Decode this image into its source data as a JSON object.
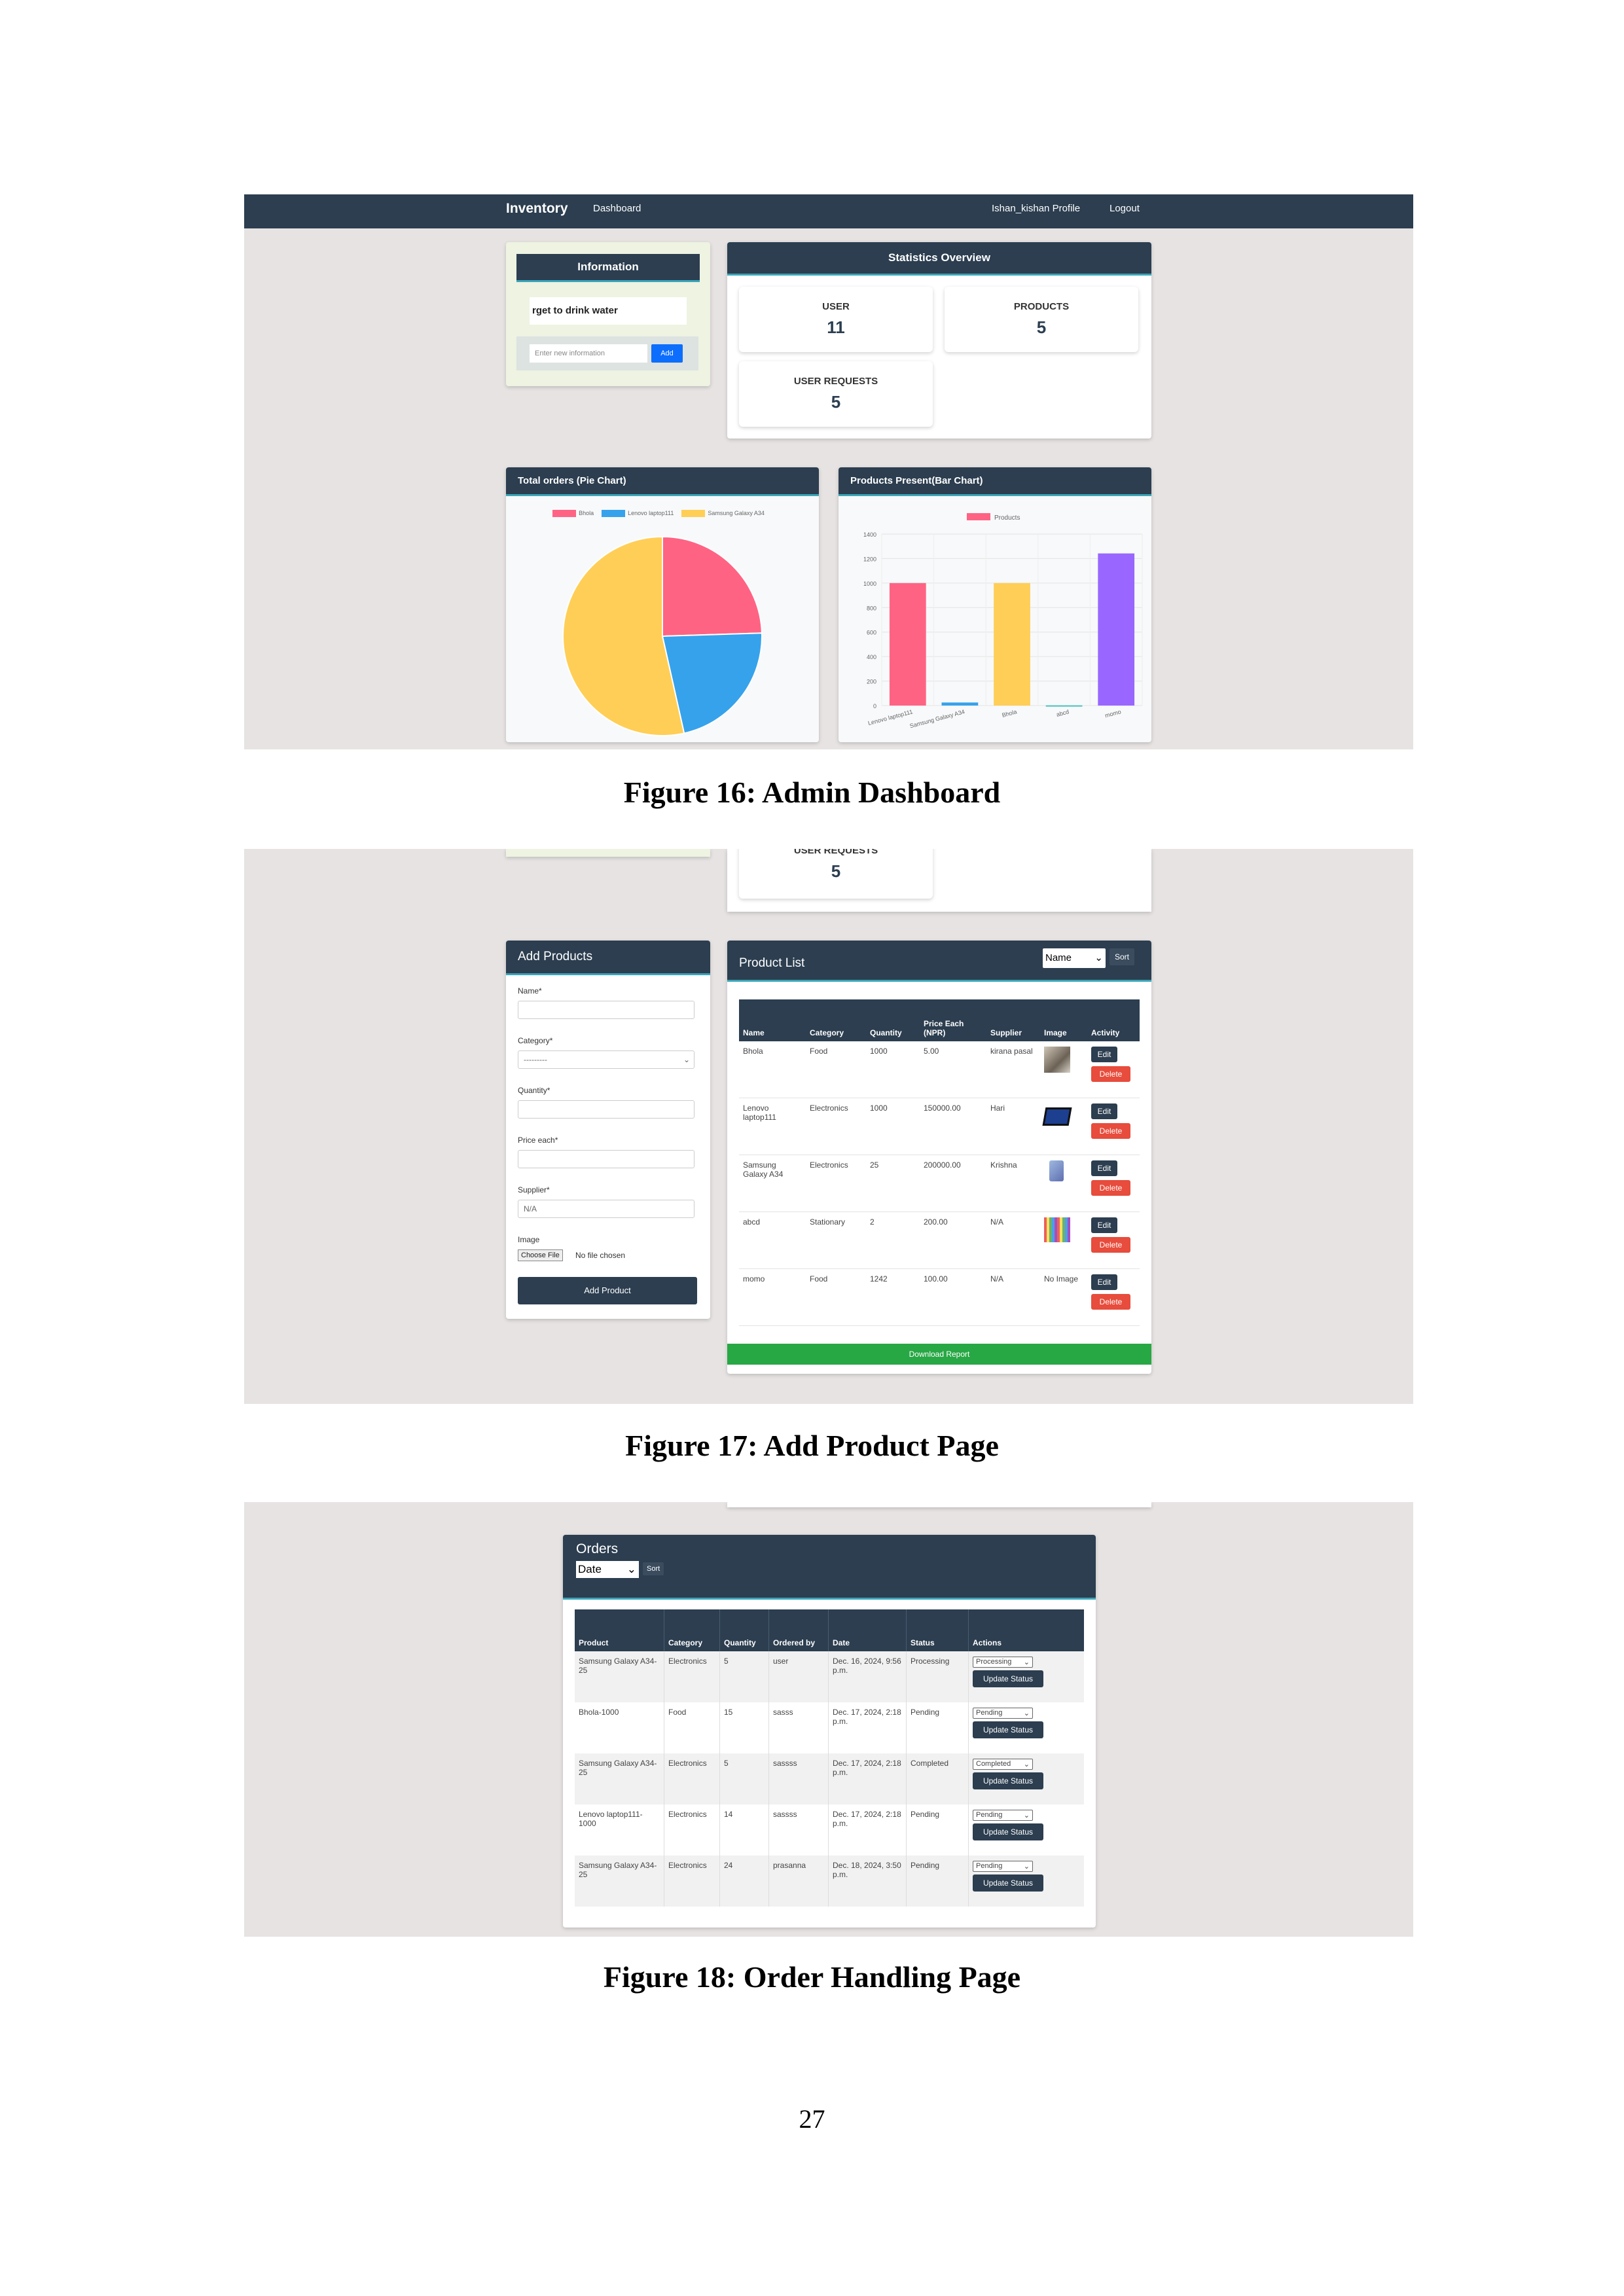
{
  "fig16": {
    "caption": "Figure 16: Admin Dashboard",
    "nav": {
      "brand": "Inventory",
      "dashboard": "Dashboard",
      "profile": "Ishan_kishan Profile",
      "logout": "Logout"
    },
    "info": {
      "title": "Information",
      "note": "rget to drink water",
      "placeholder": "Enter new information",
      "add": "Add"
    },
    "stats": {
      "title": "Statistics Overview",
      "user_label": "USER",
      "user_value": "11",
      "products_label": "PRODUCTS",
      "products_value": "5",
      "requests_label": "USER REQUESTS",
      "requests_value": "5"
    },
    "pie_title": "Total orders (Pie Chart)",
    "bar_title": "Products Present(Bar Chart)"
  },
  "chart_data": [
    {
      "type": "pie",
      "title": "Total orders (Pie Chart)",
      "categories": [
        "Bhola",
        "Lenovo laptop111",
        "Samsung Galaxy A34"
      ],
      "values": [
        24.5,
        22,
        53.5
      ],
      "colors": [
        "#ff6384",
        "#36a2eb",
        "#ffce56"
      ],
      "legend": "top"
    },
    {
      "type": "bar",
      "title": "Products Present(Bar Chart)",
      "categories": [
        "Lenovo laptop111",
        "Samsung Galaxy A34",
        "Bhola",
        "abcd",
        "momo"
      ],
      "series": [
        {
          "name": "Products",
          "values": [
            1000,
            25,
            1000,
            2,
            1242
          ]
        }
      ],
      "colors": [
        "#ff6384",
        "#36a2eb",
        "#ffce56",
        "#4bc0c0",
        "#9966ff"
      ],
      "ylim": [
        0,
        1400
      ],
      "yticks": [
        "0",
        "200",
        "400",
        "600",
        "800",
        "1000",
        "1200",
        "1400"
      ],
      "grid": true,
      "legend": "top"
    }
  ],
  "fig17": {
    "caption": "Figure 17: Add Product Page",
    "requests_label": "USER REQUESTS",
    "requests_value": "5",
    "form": {
      "title": "Add Products",
      "name_label": "Name*",
      "category_label": "Category*",
      "category_value": "---------",
      "quantity_label": "Quantity*",
      "price_label": "Price each*",
      "supplier_label": "Supplier*",
      "supplier_value": "N/A",
      "image_label": "Image",
      "choose_file": "Choose File",
      "no_file": "No file chosen",
      "submit": "Add Product"
    },
    "list": {
      "title": "Product List",
      "sort_select": "Name",
      "sort_button": "Sort",
      "headers": [
        "Name",
        "Category",
        "Quantity",
        "Price Each (NPR)",
        "Supplier",
        "Image",
        "Activity"
      ],
      "rows": [
        {
          "name": "Bhola",
          "category": "Food",
          "quantity": "1000",
          "price": "5.00",
          "supplier": "kirana pasal",
          "image": ""
        },
        {
          "name": "Lenovo laptop111",
          "category": "Electronics",
          "quantity": "1000",
          "price": "150000.00",
          "supplier": "Hari",
          "image": ""
        },
        {
          "name": "Samsung Galaxy A34",
          "category": "Electronics",
          "quantity": "25",
          "price": "200000.00",
          "supplier": "Krishna",
          "image": ""
        },
        {
          "name": "abcd",
          "category": "Stationary",
          "quantity": "2",
          "price": "200.00",
          "supplier": "N/A",
          "image": ""
        },
        {
          "name": "momo",
          "category": "Food",
          "quantity": "1242",
          "price": "100.00",
          "supplier": "N/A",
          "image": "No Image"
        }
      ],
      "edit": "Edit",
      "delete": "Delete",
      "download": "Download Report"
    }
  },
  "fig18": {
    "caption": "Figure 18: Order Handling Page",
    "title": "Orders",
    "sort_select": "Date",
    "sort_button": "Sort",
    "headers": [
      "Product",
      "Category",
      "Quantity",
      "Ordered by",
      "Date",
      "Status",
      "Actions"
    ],
    "rows": [
      {
        "product": "Samsung Galaxy A34-25",
        "category": "Electronics",
        "quantity": "5",
        "by": "user",
        "date": "Dec. 16, 2024, 9:56 p.m.",
        "status": "Processing",
        "select": "Processing"
      },
      {
        "product": "Bhola-1000",
        "category": "Food",
        "quantity": "15",
        "by": "sasss",
        "date": "Dec. 17, 2024, 2:18 p.m.",
        "status": "Pending",
        "select": "Pending"
      },
      {
        "product": "Samsung Galaxy A34-25",
        "category": "Electronics",
        "quantity": "5",
        "by": "sassss",
        "date": "Dec. 17, 2024, 2:18 p.m.",
        "status": "Completed",
        "select": "Completed"
      },
      {
        "product": "Lenovo laptop111-1000",
        "category": "Electronics",
        "quantity": "14",
        "by": "sassss",
        "date": "Dec. 17, 2024, 2:18 p.m.",
        "status": "Pending",
        "select": "Pending"
      },
      {
        "product": "Samsung Galaxy A34-25",
        "category": "Electronics",
        "quantity": "24",
        "by": "prasanna",
        "date": "Dec. 18, 2024, 3:50 p.m.",
        "status": "Pending",
        "select": "Pending"
      }
    ],
    "update": "Update Status"
  },
  "page_number": "27"
}
